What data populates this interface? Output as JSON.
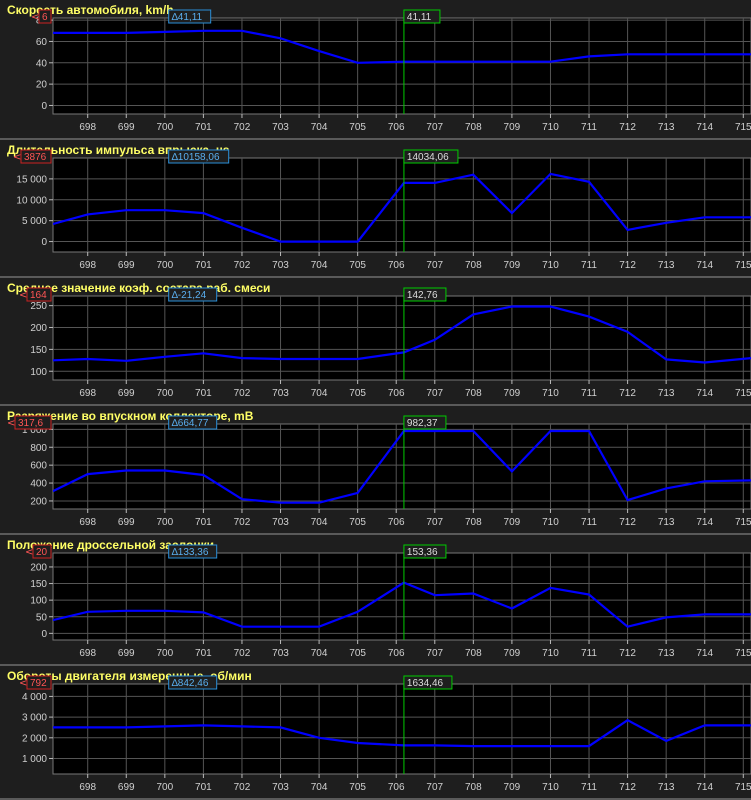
{
  "colors": {
    "panel_bg": "#000000",
    "grid": "#555555",
    "line": "#0000ff",
    "cursor": "#00cc00",
    "title": "#ffff66",
    "delta_box": "#2a8fd8",
    "marker_box": "#cc2222"
  },
  "x_ticks": [
    "698",
    "699",
    "700",
    "701",
    "702",
    "703",
    "704",
    "705",
    "706",
    "707",
    "708",
    "709",
    "710",
    "711",
    "712",
    "713",
    "714",
    "715"
  ],
  "chart_data": [
    {
      "type": "line",
      "title": "Скорость автомобиля, km/h",
      "marker": "6",
      "delta": "∆41,11",
      "cursor_value": "41,11",
      "x": [
        697.1,
        698,
        699,
        700,
        701,
        702,
        703,
        704,
        705,
        706.2,
        707,
        708,
        709,
        710,
        711,
        712,
        713,
        714,
        715.2
      ],
      "y": [
        68,
        68,
        68,
        69,
        70,
        70,
        63,
        51,
        40,
        41,
        41,
        41,
        41,
        41,
        46,
        48,
        48,
        48,
        48
      ],
      "ylim": [
        -8,
        82
      ],
      "yticks": [
        "0",
        "20",
        "40",
        "60",
        "80"
      ]
    },
    {
      "type": "line",
      "title": "Длительность импульса впрыска, µs",
      "marker": "3876",
      "delta": "∆10158,06",
      "cursor_value": "14034,06",
      "x": [
        697.1,
        698,
        699,
        700,
        701,
        702,
        703,
        704,
        705,
        706.2,
        707,
        708,
        709,
        710,
        711,
        712,
        713,
        714,
        715.2
      ],
      "y": [
        4200,
        6500,
        7500,
        7500,
        6800,
        3300,
        0,
        0,
        0,
        14034,
        14034,
        16000,
        6800,
        16200,
        14300,
        2800,
        4500,
        5800,
        5800
      ],
      "ylim": [
        -2500,
        20000
      ],
      "yticks": [
        "0",
        "5 000",
        "10 000",
        "15 000"
      ]
    },
    {
      "type": "line",
      "title": "Среднее значение коэф. состава раб. смеси",
      "marker": "164",
      "delta": "∆-21,24",
      "cursor_value": "142,76",
      "x": [
        697.1,
        698,
        699,
        700,
        701,
        702,
        703,
        704,
        705,
        706.2,
        707,
        708,
        709,
        710,
        711,
        712,
        713,
        714,
        715.2
      ],
      "y": [
        125,
        128,
        124,
        133,
        141,
        130,
        128,
        128,
        128,
        143,
        172,
        230,
        248,
        248,
        225,
        190,
        127,
        120,
        130
      ],
      "ylim": [
        80,
        272
      ],
      "yticks": [
        "100",
        "150",
        "200",
        "250"
      ]
    },
    {
      "type": "line",
      "title": "Разряжение во впускном коллекторе, mB",
      "marker": "317,6",
      "delta": "∆664,77",
      "cursor_value": "982,37",
      "x": [
        697.1,
        698,
        699,
        700,
        701,
        702,
        703,
        704,
        705,
        706.2,
        707,
        708,
        709,
        710,
        711,
        712,
        713,
        714,
        715.2
      ],
      "y": [
        310,
        500,
        540,
        540,
        490,
        220,
        180,
        180,
        290,
        982,
        982,
        982,
        530,
        982,
        982,
        210,
        340,
        420,
        430
      ],
      "ylim": [
        110,
        1060
      ],
      "yticks": [
        "200",
        "400",
        "600",
        "800",
        "1 000"
      ]
    },
    {
      "type": "line",
      "title": "Положение дроссельной заслонки",
      "marker": "20",
      "delta": "∆133,36",
      "cursor_value": "153,36",
      "x": [
        697.1,
        698,
        699,
        700,
        701,
        702,
        703,
        704,
        705,
        706.2,
        707,
        708,
        709,
        710,
        711,
        712,
        713,
        714,
        715.2
      ],
      "y": [
        40,
        65,
        68,
        68,
        63,
        20,
        20,
        20,
        65,
        153,
        115,
        120,
        75,
        137,
        117,
        20,
        48,
        57,
        57
      ],
      "ylim": [
        -20,
        242
      ],
      "yticks": [
        "0",
        "50",
        "100",
        "150",
        "200"
      ]
    },
    {
      "type": "line",
      "title": "Обороты двигателя измеренные, об/мин",
      "marker": "792",
      "delta": "∆842,46",
      "cursor_value": "1634,46",
      "x": [
        697.1,
        698,
        699,
        700,
        701,
        702,
        703,
        704,
        705,
        706.2,
        707,
        708,
        709,
        710,
        711,
        712,
        713,
        714,
        715.2
      ],
      "y": [
        2500,
        2500,
        2500,
        2550,
        2600,
        2550,
        2500,
        2000,
        1750,
        1634,
        1634,
        1600,
        1600,
        1600,
        1600,
        2850,
        1850,
        2600,
        2600
      ],
      "ylim": [
        250,
        4600
      ],
      "yticks": [
        "1 000",
        "2 000",
        "3 000",
        "4 000"
      ]
    }
  ]
}
